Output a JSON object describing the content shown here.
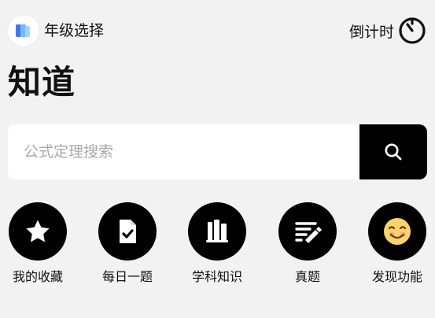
{
  "header": {
    "grade_label": "年级选择",
    "countdown_label": "倒计时"
  },
  "title": "知道",
  "search": {
    "placeholder": "公式定理搜索"
  },
  "features": [
    {
      "label": "我的收藏",
      "icon": "star-icon"
    },
    {
      "label": "每日一题",
      "icon": "daily-question-icon"
    },
    {
      "label": "学科知识",
      "icon": "books-icon"
    },
    {
      "label": "真题",
      "icon": "exam-edit-icon"
    },
    {
      "label": "发现功能",
      "icon": "smile-emoji-icon"
    }
  ],
  "colors": {
    "background": "#f2f2f2",
    "accent_black": "#000000",
    "placeholder": "#a9a9a9",
    "logo_blue": "#3f76ee",
    "logo_light_blue": "#72b8ff",
    "emoji_yellow": "#ffd36a"
  }
}
